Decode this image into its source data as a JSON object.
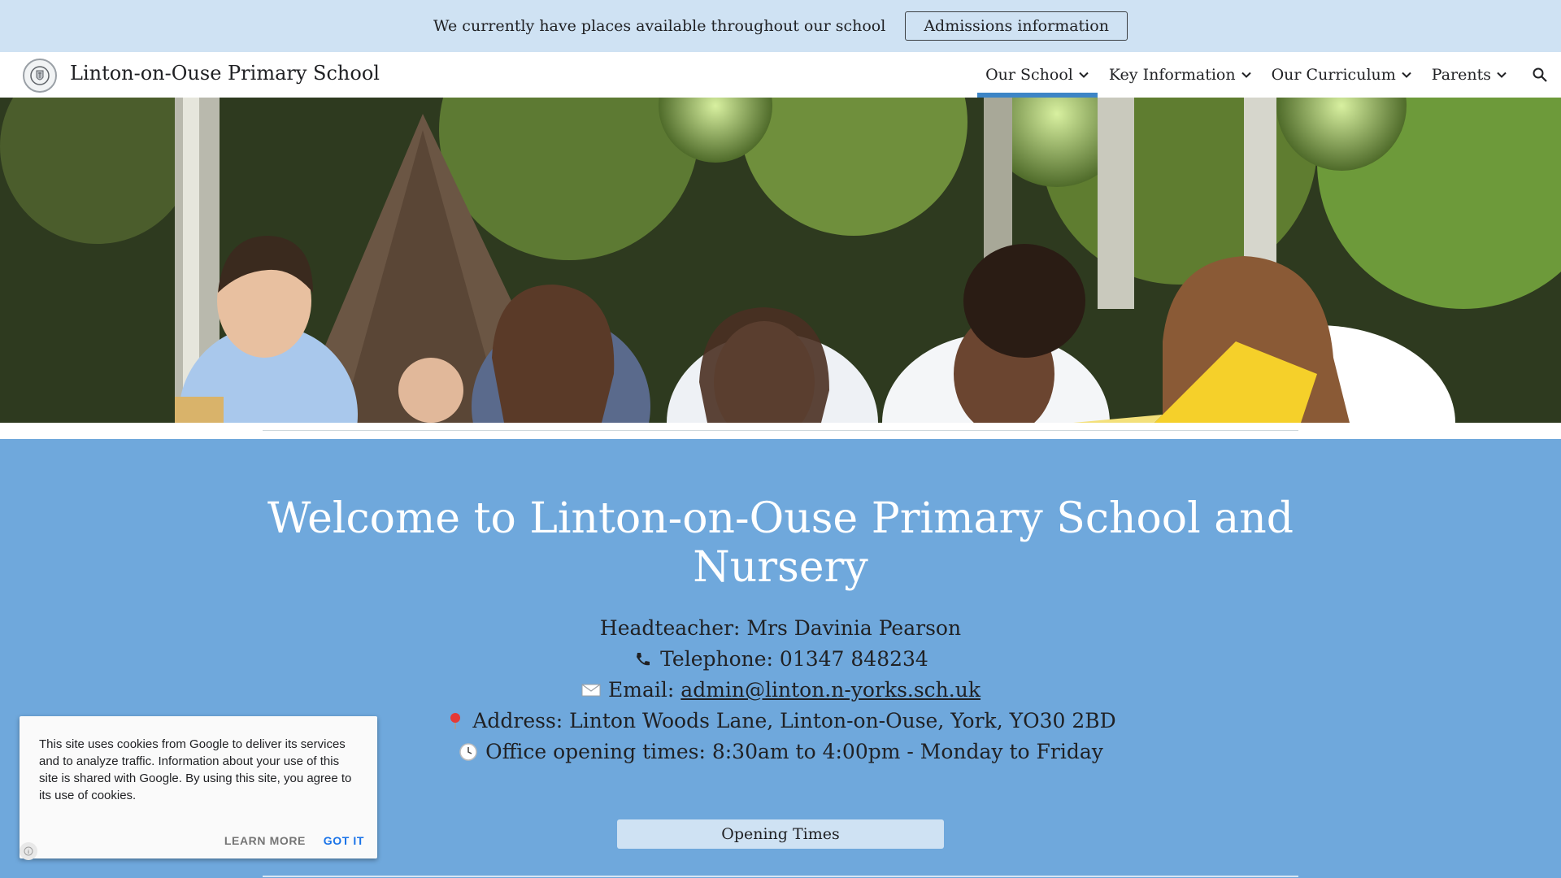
{
  "announcement": {
    "text": "We currently have places available throughout our school",
    "button_label": "Admissions information"
  },
  "header": {
    "site_title": "Linton-on-Ouse Primary School",
    "nav": [
      {
        "label": "Our School",
        "active": true
      },
      {
        "label": "Key Information",
        "active": false
      },
      {
        "label": "Our Curriculum",
        "active": false
      },
      {
        "label": "Parents",
        "active": false
      }
    ],
    "icons": {
      "logo": "school-crest",
      "search": "search-icon",
      "dropdown": "chevron-down-icon"
    }
  },
  "hero": {
    "image": "children-reading-outdoors"
  },
  "main": {
    "heading": "Welcome to Linton-on-Ouse Primary School and Nursery",
    "headteacher": "Headteacher: Mrs Davinia Pearson",
    "telephone": "Telephone: 01347 848234",
    "email_label": "Email:",
    "email": "admin@linton.n-yorks.sch.uk",
    "address": "Address: Linton Woods Lane, Linton-on-Ouse, York, YO30 2BD",
    "office_hours": "Office opening times: 8:30am to 4:00pm - Monday to Friday",
    "opening_times_button": "Opening Times"
  },
  "cookie_banner": {
    "text": "This site uses cookies from Google to deliver its services and to analyze traffic. Information about your use of this site is shared with Google. By using this site, you agree to its use of cookies.",
    "learn_more": "LEARN MORE",
    "got_it": "GOT IT"
  },
  "colors": {
    "announcement_bg": "#cfe2f3",
    "main_bg": "#6fa8dc",
    "active_tab": "#3d85c6",
    "got_it": "#1a73e8"
  }
}
